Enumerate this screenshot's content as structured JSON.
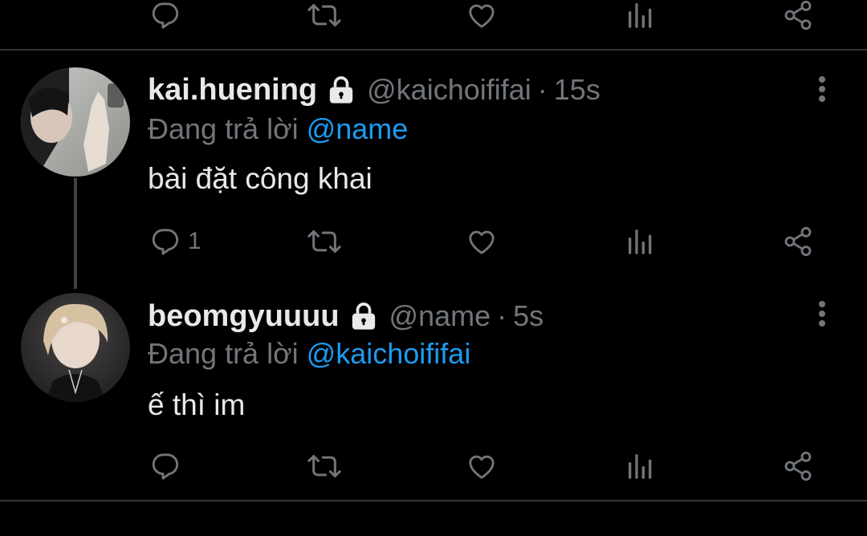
{
  "tweets": [
    {
      "display_name": "kai.huening",
      "handle": "@kaichoififai",
      "separator": "·",
      "time": "15s",
      "replying_prefix": "Đang trả lời",
      "replying_to": "@name",
      "text": "bài đặt công khai",
      "reply_count": "1",
      "protected": true
    },
    {
      "display_name": "beomgyuuuu",
      "handle": "@name",
      "separator": "·",
      "time": "5s",
      "replying_prefix": "Đang trả lời",
      "replying_to": "@kaichoififai",
      "text": "ế thì im",
      "reply_count": "",
      "protected": true
    }
  ],
  "icons": {
    "reply": "reply-icon",
    "retweet": "retweet-icon",
    "like": "heart-icon",
    "analytics": "analytics-icon",
    "share": "share-icon",
    "more": "more-vertical-icon",
    "lock": "lock-icon"
  },
  "colors": {
    "background": "#000000",
    "text_primary": "#e7e9ea",
    "text_secondary": "#71767b",
    "accent": "#1d9bf0",
    "divider": "#2f3336"
  }
}
